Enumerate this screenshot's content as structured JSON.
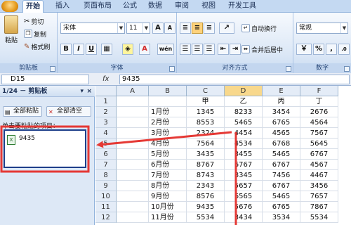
{
  "tabs": [
    "开始",
    "插入",
    "页面布局",
    "公式",
    "数据",
    "审阅",
    "视图",
    "开发工具"
  ],
  "ribbon": {
    "clipboard": {
      "label": "剪贴板",
      "paste": "粘贴",
      "cut": "剪切",
      "copy": "复制",
      "format_painter": "格式刷"
    },
    "font": {
      "label": "字体",
      "name": "宋体",
      "size": "11",
      "bold": "B",
      "italic": "I",
      "underline": "U",
      "grow": "A",
      "shrink": "A",
      "phonetic": "wén"
    },
    "alignment": {
      "label": "对齐方式",
      "wrap": "自动换行",
      "merge": "合并后居中"
    },
    "number": {
      "label": "数字",
      "format": "常规",
      "percent": "%",
      "comma": ","
    }
  },
  "formula_bar": {
    "name_box": "D15",
    "fx": "fx",
    "content": "9435"
  },
  "clipboard_pane": {
    "title": "1/24 － 剪贴板",
    "close": "×",
    "menu": "▾",
    "paste_all": "全部粘贴",
    "clear_all": "全部清空",
    "hint": "单击要粘贴的项目：",
    "items": [
      "9435"
    ]
  },
  "sheet": {
    "columns": [
      "A",
      "B",
      "C",
      "D",
      "E",
      "F"
    ],
    "selected_column": "D",
    "rows": [
      "1",
      "2",
      "3",
      "4",
      "5",
      "6",
      "7",
      "8",
      "9",
      "10",
      "11",
      "12"
    ],
    "cells": [
      [
        "",
        "",
        "甲",
        "乙",
        "丙",
        "丁"
      ],
      [
        "",
        "1月份",
        "1345",
        "8233",
        "3454",
        "2676"
      ],
      [
        "",
        "2月份",
        "8553",
        "5465",
        "6765",
        "4564"
      ],
      [
        "",
        "3月份",
        "2324",
        "4454",
        "4565",
        "7567"
      ],
      [
        "",
        "4月份",
        "7564",
        "4534",
        "6768",
        "5645"
      ],
      [
        "",
        "5月份",
        "3435",
        "3455",
        "5465",
        "6767"
      ],
      [
        "",
        "6月份",
        "8767",
        "6767",
        "6767",
        "4567"
      ],
      [
        "",
        "7月份",
        "8743",
        "8345",
        "7456",
        "4467"
      ],
      [
        "",
        "8月份",
        "2343",
        "5657",
        "6767",
        "3456"
      ],
      [
        "",
        "9月份",
        "8576",
        "6565",
        "5465",
        "7657"
      ],
      [
        "",
        "10月份",
        "9435",
        "5676",
        "6765",
        "7867"
      ],
      [
        "",
        "11月份",
        "5534",
        "3434",
        "3534",
        "5534"
      ]
    ]
  },
  "colors": {
    "annotation": "#e53935",
    "selection_border": "#1e3f8a"
  }
}
